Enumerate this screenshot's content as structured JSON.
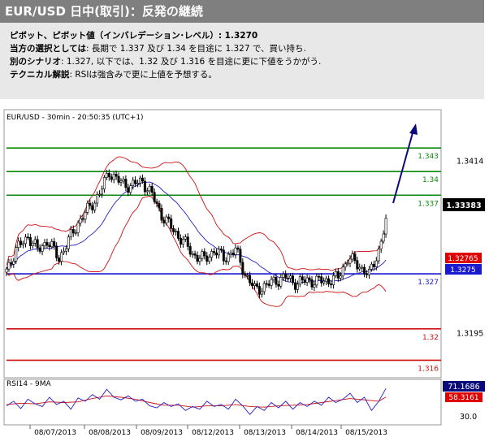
{
  "header": {
    "title": "EUR/USD 日中(取引)：反発の継続"
  },
  "analysis": {
    "pivot_label": "ピボット、ピボット値（インバレデーション･レベル）: 1.3270",
    "choice_label": "当方の選択としては",
    "choice_text": ": 長期で 1.337 及び 1.34 を目途に 1.327 で、買い持ち.",
    "alt_label": "別のシナリオ",
    "alt_text": ": 1.327, 以下では、1.32 及び 1.316 を目途に更に下値をうかがう.",
    "tech_label": "テクニカル解説",
    "tech_text": ": RSIは強含みで更に上値を予想する。"
  },
  "chart_data": {
    "type": "candlestick",
    "title": "EUR/USD - 30min - 20:50:35 (UTC+1)",
    "ylim": [
      1.3145,
      1.3455
    ],
    "y_ticks": [
      1.3414,
      1.3195
    ],
    "x_labels": [
      "08/07/2013",
      "08/08/2013",
      "08/09/2013",
      "08/12/2013",
      "08/13/2013",
      "08/14/2013",
      "08/15/2013"
    ],
    "current_price": "1.33383",
    "level_tags": [
      "1.32765",
      "1.3275"
    ],
    "levels": [
      {
        "value": 1.343,
        "label": "1.343",
        "color": "#0a8a0a"
      },
      {
        "value": 1.34,
        "label": "1.34",
        "color": "#0a8a0a"
      },
      {
        "value": 1.337,
        "label": "1.337",
        "color": "#0a8a0a"
      },
      {
        "value": 1.327,
        "label": "1.327",
        "color": "#1a1ad0"
      },
      {
        "value": 1.32,
        "label": "1.32",
        "color": "#d01010"
      },
      {
        "value": 1.316,
        "label": "1.316",
        "color": "#d01010"
      }
    ],
    "price_path": [
      [
        0,
        1.3275
      ],
      [
        4,
        1.33
      ],
      [
        9,
        1.3318
      ],
      [
        13,
        1.33
      ],
      [
        17,
        1.3312
      ],
      [
        22,
        1.329
      ],
      [
        26,
        1.3312
      ],
      [
        30,
        1.3335
      ],
      [
        35,
        1.3355
      ],
      [
        39,
        1.3372
      ],
      [
        43,
        1.34
      ],
      [
        48,
        1.3385
      ],
      [
        52,
        1.3382
      ],
      [
        57,
        1.3388
      ],
      [
        61,
        1.337
      ],
      [
        65,
        1.3345
      ],
      [
        70,
        1.3325
      ],
      [
        74,
        1.3312
      ],
      [
        78,
        1.3295
      ],
      [
        83,
        1.3288
      ],
      [
        87,
        1.33
      ],
      [
        91,
        1.329
      ],
      [
        96,
        1.33
      ],
      [
        100,
        1.327
      ],
      [
        104,
        1.325
      ],
      [
        109,
        1.3255
      ],
      [
        113,
        1.3262
      ],
      [
        117,
        1.3265
      ],
      [
        122,
        1.3258
      ],
      [
        126,
        1.3262
      ],
      [
        130,
        1.326
      ],
      [
        135,
        1.3262
      ],
      [
        139,
        1.3265
      ],
      [
        143,
        1.329
      ],
      [
        148,
        1.328
      ],
      [
        152,
        1.3268
      ],
      [
        156,
        1.33
      ],
      [
        159,
        1.3336
      ]
    ],
    "rsi": {
      "label": "RSI14 - 9MA",
      "value": "71.1686",
      "ma_value": "58.3161",
      "ylim": [
        20,
        80
      ],
      "y_ticks": [
        30.0
      ],
      "rsi_path": [
        [
          0,
          45
        ],
        [
          3,
          52
        ],
        [
          6,
          41
        ],
        [
          9,
          55
        ],
        [
          12,
          48
        ],
        [
          15,
          44
        ],
        [
          18,
          58
        ],
        [
          21,
          47
        ],
        [
          24,
          52
        ],
        [
          27,
          40
        ],
        [
          30,
          57
        ],
        [
          33,
          52
        ],
        [
          36,
          62
        ],
        [
          39,
          55
        ],
        [
          42,
          70
        ],
        [
          45,
          58
        ],
        [
          48,
          54
        ],
        [
          51,
          60
        ],
        [
          54,
          52
        ],
        [
          57,
          55
        ],
        [
          60,
          45
        ],
        [
          63,
          42
        ],
        [
          66,
          50
        ],
        [
          69,
          44
        ],
        [
          72,
          48
        ],
        [
          75,
          38
        ],
        [
          78,
          44
        ],
        [
          81,
          40
        ],
        [
          84,
          52
        ],
        [
          87,
          44
        ],
        [
          90,
          47
        ],
        [
          93,
          40
        ],
        [
          96,
          55
        ],
        [
          99,
          45
        ],
        [
          102,
          32
        ],
        [
          105,
          44
        ],
        [
          108,
          38
        ],
        [
          111,
          50
        ],
        [
          114,
          42
        ],
        [
          117,
          52
        ],
        [
          120,
          40
        ],
        [
          123,
          50
        ],
        [
          126,
          44
        ],
        [
          129,
          52
        ],
        [
          132,
          46
        ],
        [
          135,
          58
        ],
        [
          138,
          50
        ],
        [
          141,
          55
        ],
        [
          144,
          64
        ],
        [
          147,
          50
        ],
        [
          150,
          58
        ],
        [
          153,
          38
        ],
        [
          156,
          52
        ],
        [
          159,
          71.17
        ]
      ],
      "ma_path": [
        [
          0,
          47
        ],
        [
          6,
          49
        ],
        [
          12,
          48
        ],
        [
          18,
          51
        ],
        [
          24,
          50
        ],
        [
          30,
          51
        ],
        [
          36,
          56
        ],
        [
          42,
          60
        ],
        [
          48,
          58
        ],
        [
          54,
          55
        ],
        [
          60,
          50
        ],
        [
          66,
          46
        ],
        [
          72,
          46
        ],
        [
          78,
          43
        ],
        [
          84,
          45
        ],
        [
          90,
          45
        ],
        [
          96,
          47
        ],
        [
          102,
          44
        ],
        [
          108,
          43
        ],
        [
          114,
          45
        ],
        [
          120,
          46
        ],
        [
          126,
          47
        ],
        [
          132,
          50
        ],
        [
          138,
          53
        ],
        [
          144,
          56
        ],
        [
          150,
          54
        ],
        [
          156,
          52
        ],
        [
          159,
          58.32
        ]
      ]
    }
  }
}
